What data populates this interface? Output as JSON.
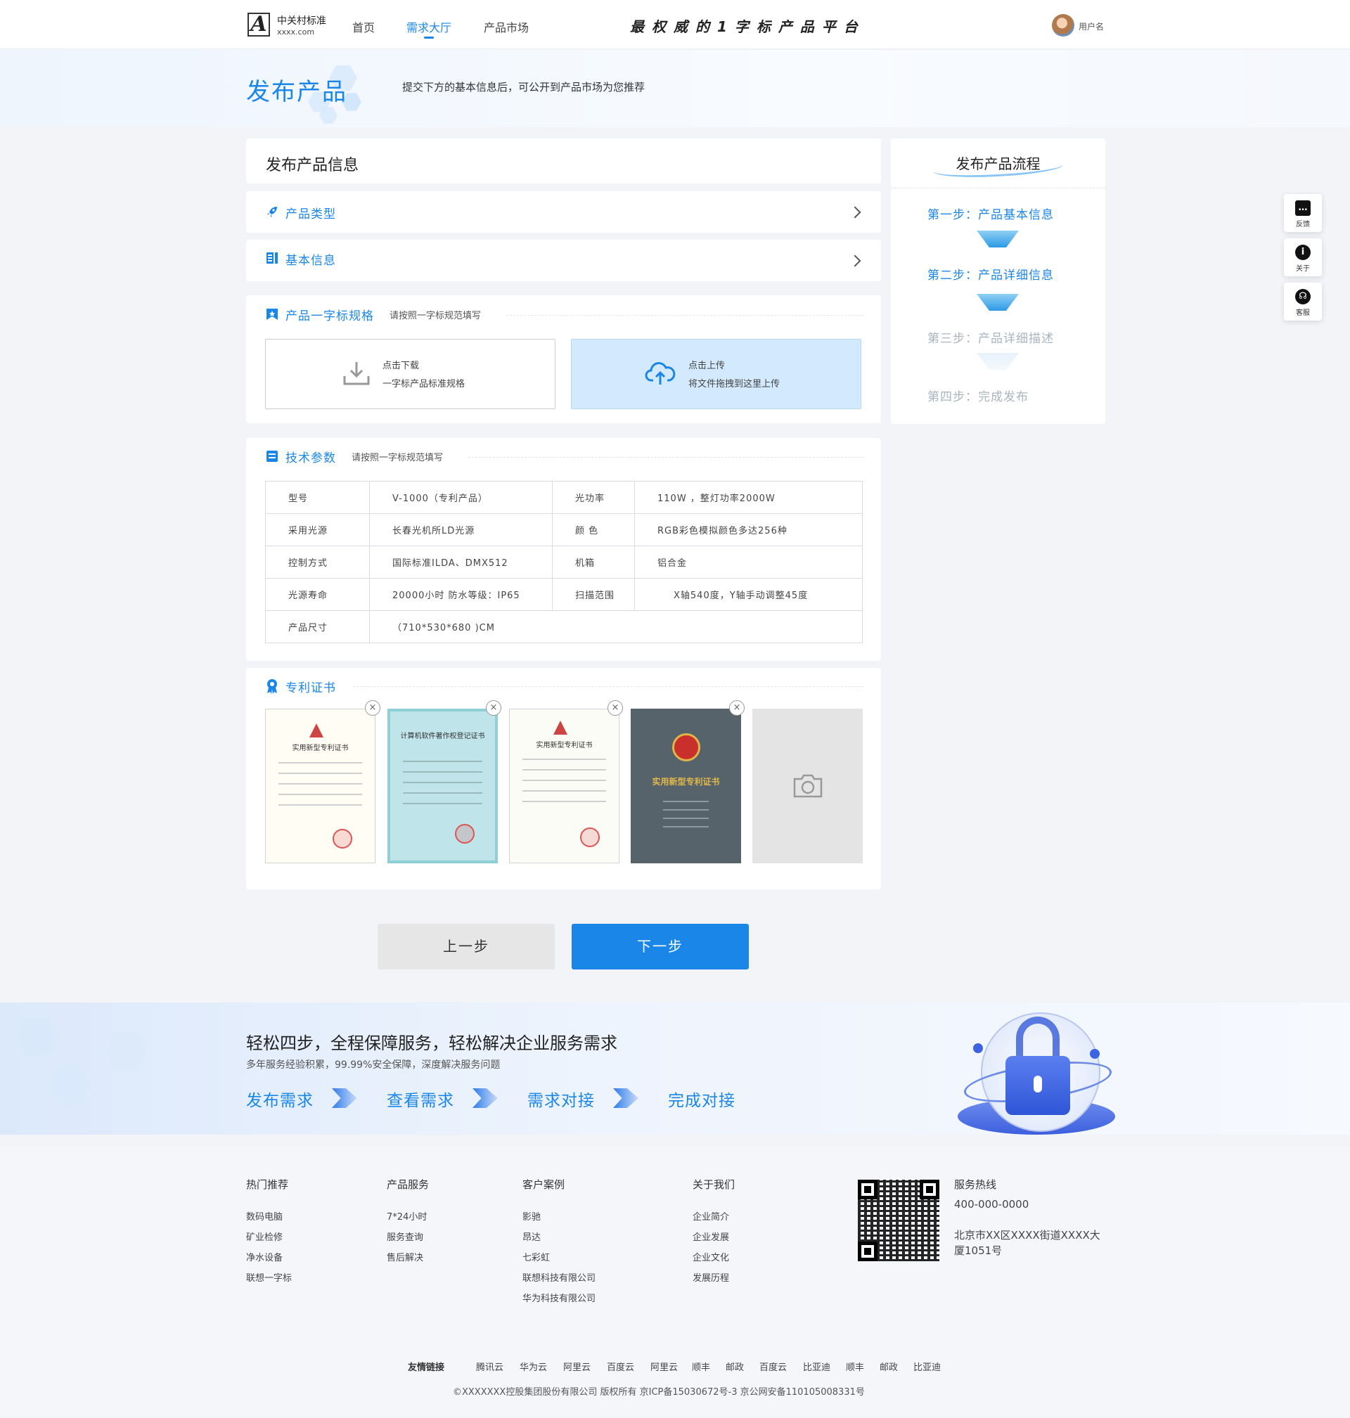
{
  "header": {
    "logo_mark": "A",
    "logo_name": "中关村标准",
    "logo_domain": "xxxx.com",
    "nav": [
      "首页",
      "需求大厅",
      "产品市场"
    ],
    "active_nav": "需求大厅",
    "slogan": "最权威的1字标产品平台",
    "username": "用户名"
  },
  "banner": {
    "title": "发布产品",
    "subtitle": "提交下方的基本信息后，可公开到产品市场为您推荐"
  },
  "form": {
    "title": "发布产品信息",
    "product_type": "产品类型",
    "basic_info": "基本信息",
    "spec": {
      "title": "产品一字标规格",
      "hint": "请按照一字标规范填写",
      "download_l1": "点击下载",
      "download_l2": "一字标产品标准规格",
      "upload_l1": "点击上传",
      "upload_l2": "将文件拖拽到这里上传"
    },
    "tech": {
      "title": "技术参数",
      "hint": "请按照一字标规范填写",
      "rows": [
        [
          "型号",
          "V-1000（专利产品）",
          "光功率",
          "110W ，整灯功率2000W"
        ],
        [
          "采用光源",
          "长春光机所LD光源",
          "颜 色",
          "RGB彩色模拟颜色多达256种"
        ],
        [
          "控制方式",
          "国际标准ILDA、DMX512",
          "机箱",
          "铝合金"
        ],
        [
          "光源寿命",
          "20000小时  防水等级：IP65",
          "扫描范围",
          "X轴540度，Y轴手动调整45度"
        ],
        [
          "产品尺寸",
          "（710*530*680 )CM"
        ]
      ]
    },
    "patent": {
      "title": "专利证书",
      "certs": [
        {
          "name": "实用新型专利证书",
          "bg": "#f8f6e8"
        },
        {
          "name": "计算机软件著作权登记证书",
          "bg": "#b9e0e6"
        },
        {
          "name": "实用新型专利证书",
          "bg": "#f9faf3"
        },
        {
          "name": "实用新型专利证书",
          "bg": "#56636a"
        }
      ]
    },
    "prev": "上一步",
    "next": "下一步"
  },
  "flow": {
    "title": "发布产品流程",
    "steps": [
      "第一步：产品基本信息",
      "第二步：产品详细信息",
      "第三步：产品详细描述",
      "第四步：完成发布"
    ],
    "active_steps": 2
  },
  "float": [
    {
      "label": "反馈",
      "icon": "message-icon"
    },
    {
      "label": "关于",
      "icon": "info-icon"
    },
    {
      "label": "客服",
      "icon": "headset-icon"
    }
  ],
  "promo": {
    "heading": "轻松四步，全程保障服务，轻松解决企业服务需求",
    "sub": "多年服务经验积累，99.99%安全保障，深度解决服务问题",
    "steps": [
      "发布需求",
      "查看需求",
      "需求对接",
      "完成对接"
    ]
  },
  "footer": {
    "cols": [
      {
        "title": "热门推荐",
        "items": [
          "数码电脑",
          "矿业检修",
          "净水设备",
          "联想一字标"
        ]
      },
      {
        "title": "产品服务",
        "items": [
          "7*24小时",
          "服务查询",
          "售后解决"
        ]
      },
      {
        "title": "客户案例",
        "items": [
          "影驰",
          "昂达",
          "七彩虹",
          "联想科技有限公司",
          "华为科技有限公司"
        ]
      },
      {
        "title": "关于我们",
        "items": [
          "企业简介",
          "企业发展",
          "企业文化",
          "发展历程"
        ]
      }
    ],
    "hotline_label": "服务热线",
    "hotline": "400-000-0000",
    "address": "北京市XX区XXXX街道XXXX大厦1051号",
    "links_label": "友情链接",
    "links": [
      "腾讯云",
      "华为云",
      "阿里云",
      "百度云",
      "阿里云",
      "顺丰",
      "邮政",
      "百度云",
      "比亚迪",
      "顺丰",
      "邮政",
      "比亚迪"
    ],
    "copyright": "©XXXXXXX控股集团股份有限公司 版权所有 京ICP备15030672号-3   京公网安备110105008331号"
  },
  "colors": {
    "accent": "#1a86e8",
    "upload_bg": "#d3e9fd"
  }
}
